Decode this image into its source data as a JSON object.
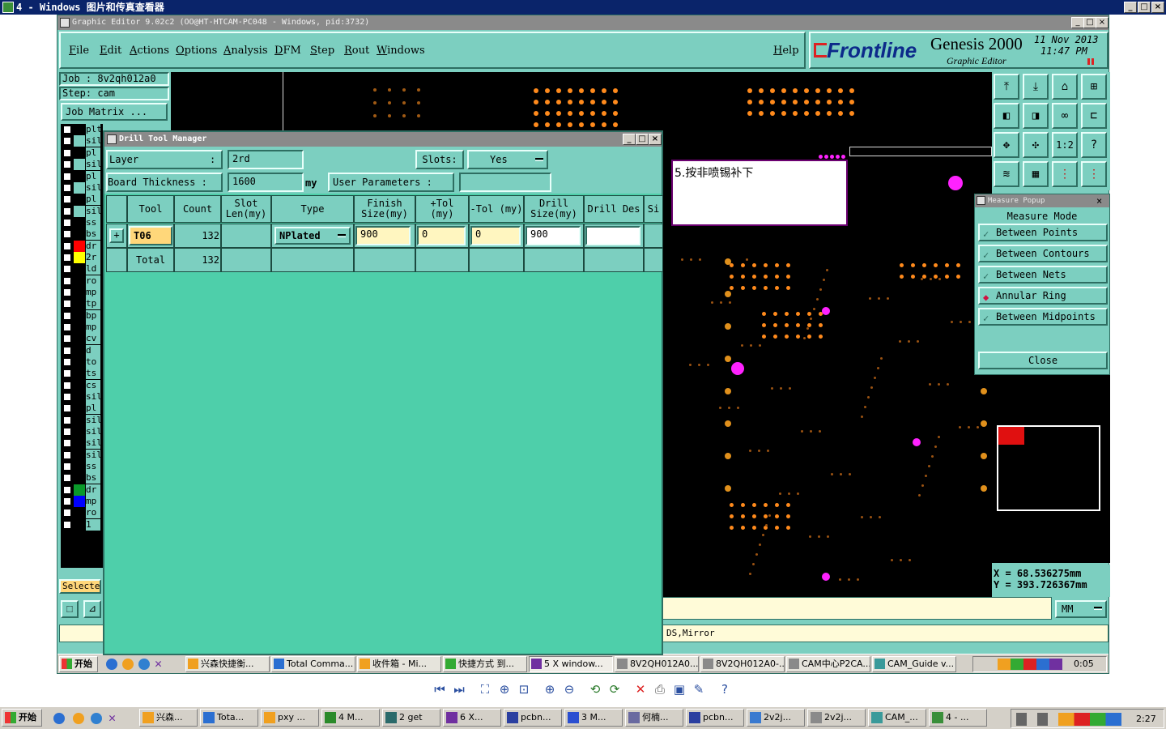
{
  "viewer": {
    "title": "4 - Windows 图片和传真查看器",
    "min": "_",
    "max": "□",
    "close": "×"
  },
  "genesis": {
    "title": "Graphic Editor 9.02c2  (OO@HT-HTCAM-PC048 - Windows, pid:3732)",
    "menu": [
      "File",
      "Edit",
      "Actions",
      "Options",
      "Analysis",
      "DFM",
      "Step",
      "Rout",
      "Windows"
    ],
    "help": "Help",
    "brand": "Frontline",
    "product": "Genesis 2000",
    "subtitle": "Graphic Editor",
    "date": "11 Nov 2013",
    "time": "11:47 PM",
    "job_label": "Job : 8v2qh012a0",
    "step_label": "Step: cam",
    "job_matrix": "Job Matrix ...",
    "selected": "Selected",
    "layers": [
      {
        "name": "plt",
        "color": "#000000"
      },
      {
        "name": "sil",
        "color": "#7ccfc0"
      },
      {
        "name": "pl",
        "color": "#000000"
      },
      {
        "name": "sil",
        "color": "#7ccfc0"
      },
      {
        "name": "pl",
        "color": "#000000"
      },
      {
        "name": "sil",
        "color": "#7ccfc0"
      },
      {
        "name": "pl",
        "color": "#000000"
      },
      {
        "name": "sil",
        "color": "#7ccfc0"
      },
      {
        "name": "ss",
        "color": "#000000"
      },
      {
        "name": "bs",
        "color": "#000000"
      },
      {
        "name": "dr",
        "color": "#ff0000"
      },
      {
        "name": "2r",
        "color": "#ffff00"
      },
      {
        "name": "ld",
        "color": "#000000"
      },
      {
        "name": "ro",
        "color": "#000000"
      },
      {
        "name": "mp",
        "color": "#000000"
      },
      {
        "name": "tp",
        "color": "#000000"
      },
      {
        "name": "bp",
        "color": "#000000"
      },
      {
        "name": "mp",
        "color": "#000000"
      },
      {
        "name": "cv",
        "color": "#000000"
      },
      {
        "name": "d",
        "color": "#000000"
      },
      {
        "name": "to",
        "color": "#000000"
      },
      {
        "name": "ts",
        "color": "#000000"
      },
      {
        "name": "cs",
        "color": "#000000"
      },
      {
        "name": "sil",
        "color": "#000000"
      },
      {
        "name": "pl",
        "color": "#000000"
      },
      {
        "name": "sil",
        "color": "#000000"
      },
      {
        "name": "sil",
        "color": "#000000"
      },
      {
        "name": "sil",
        "color": "#000000"
      },
      {
        "name": "sil",
        "color": "#000000"
      },
      {
        "name": "ss",
        "color": "#000000"
      },
      {
        "name": "bs",
        "color": "#000000"
      },
      {
        "name": "dr",
        "color": "#0a9a2a"
      },
      {
        "name": "mp",
        "color": "#0000ff"
      },
      {
        "name": "ro",
        "color": "#000000"
      },
      {
        "name": "1",
        "color": "#000000"
      }
    ],
    "annotation": "5.按非喷锡补下",
    "status_text": "DS,Mirror",
    "coord_x": "X  =  68.536275mm",
    "coord_y": "Y  =  393.726367mm",
    "units": "MM"
  },
  "drill_manager": {
    "title": "Drill Tool Manager",
    "layer_label": "Layer",
    "layer_value": "2rd",
    "slots_label": "Slots:",
    "slots_value": "Yes",
    "board_thickness_label": "Board Thickness :",
    "board_thickness_value": "1600",
    "board_thickness_unit": "my",
    "user_params_label": "User Parameters :",
    "headers": [
      "Tool",
      "Count",
      "Slot Len(my)",
      "Type",
      "Finish Size(my)",
      "+Tol (my)",
      "-Tol (my)",
      "Drill Size(my)",
      "Drill Des",
      "Si"
    ],
    "row": {
      "tool": "T06",
      "count": "132",
      "type": "NPlated",
      "finish": "900",
      "plus_tol": "0",
      "minus_tol": "0",
      "drill_size": "900"
    },
    "total_label": "Total",
    "total_count": "132"
  },
  "measure": {
    "title": "Measure Popup",
    "mode_label": "Measure Mode",
    "options": [
      "Between Points",
      "Between Contours",
      "Between Nets",
      "Annular Ring",
      "Between Midpoints"
    ],
    "selected_index": 3,
    "close": "Close"
  },
  "inner_taskbar": {
    "start": "开始",
    "items": [
      "兴森快捷衡...",
      "Total Comma...",
      "收件箱 - Mi...",
      "快捷方式 到...",
      "5 X window...",
      "8V2QH012A0...",
      "8V2QH012A0-...",
      "CAM中心P2CA...",
      "CAM_Guide v..."
    ],
    "clock": "0:05"
  },
  "outer_taskbar": {
    "start": "开始",
    "items": [
      "兴森...",
      "Tota...",
      "pxy ...",
      "4 M...",
      "2 get",
      "6 X...",
      "pcbn...",
      "3 M...",
      "何楠...",
      "pcbn...",
      "2v2j...",
      "2v2j...",
      "CAM_...",
      "4 - ..."
    ],
    "clock": "2:27"
  }
}
